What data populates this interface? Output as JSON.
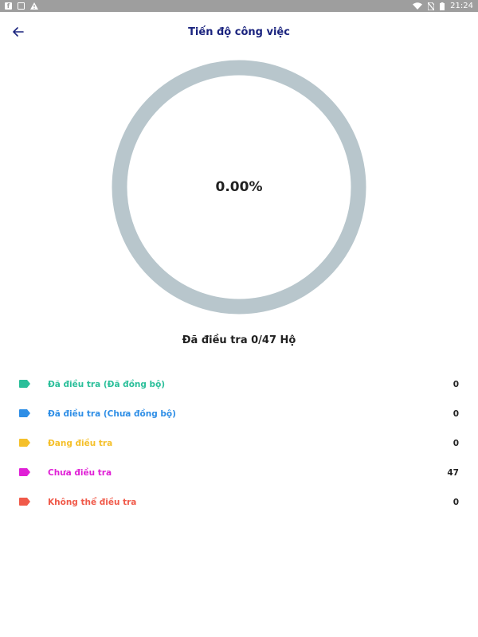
{
  "status_bar": {
    "time": "21:24",
    "left_icons": [
      "facebook-icon",
      "image-icon",
      "warning-icon"
    ],
    "right_icons": [
      "wifi-icon",
      "no-sim-icon",
      "battery-icon"
    ]
  },
  "header": {
    "title": "Tiến độ công việc",
    "back_icon": "arrow-left-icon"
  },
  "progress": {
    "percent_label": "0.00%",
    "fraction": 0.0,
    "ring_color": "#b8c6cc",
    "summary": "Đã điều tra 0/47 Hộ"
  },
  "legend": [
    {
      "label": "Đã điều tra (Đã đồng bộ)",
      "value": "0",
      "color": "#2bbf9a"
    },
    {
      "label": "Đã điều tra (Chưa đồng bộ)",
      "value": "0",
      "color": "#2e8ee6"
    },
    {
      "label": "Đang điều tra",
      "value": "0",
      "color": "#f5c02a"
    },
    {
      "label": "Chưa điều tra",
      "value": "47",
      "color": "#e020d6"
    },
    {
      "label": "Không thể điều tra",
      "value": "0",
      "color": "#f05a4a"
    }
  ]
}
